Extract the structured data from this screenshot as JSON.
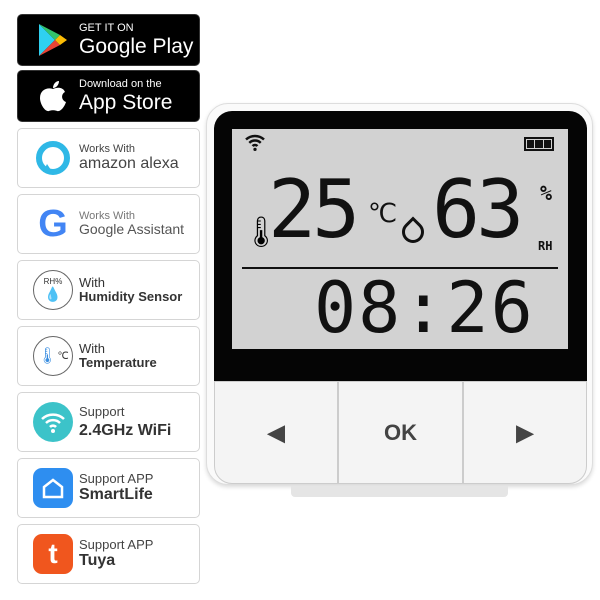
{
  "badges": [
    {
      "line1": "GET IT ON",
      "line2": "Google Play",
      "icon": "google-play-icon"
    },
    {
      "line1": "Download on the",
      "line2": "App Store",
      "icon": "apple-icon"
    },
    {
      "line1": "Works With",
      "line2": "amazon alexa",
      "icon": "alexa-icon"
    },
    {
      "line1": "Works With",
      "line2": "Google Assistant",
      "icon": "google-icon"
    },
    {
      "line1": "With",
      "line2": "Humidity Sensor",
      "icon": "humidity-icon",
      "icon_text": "RH%"
    },
    {
      "line1": "With",
      "line2": "Temperature",
      "icon": "thermometer-icon",
      "icon_text": "℃"
    },
    {
      "line1": "Support",
      "line2": "2.4GHz WiFi",
      "icon": "wifi-icon"
    },
    {
      "line1": "Support APP",
      "line2": "SmartLife",
      "icon": "smartlife-icon"
    },
    {
      "line1": "Support APP",
      "line2": "Tuya",
      "icon": "tuya-icon"
    }
  ],
  "display": {
    "temperature": "25",
    "temp_unit": "℃",
    "humidity": "63",
    "hum_unit": "%",
    "rh": "RH",
    "time": "08:26"
  },
  "buttons": {
    "left": "◀",
    "ok": "OK",
    "right": "▶"
  },
  "colors": {
    "alexa": "#2fb8e6",
    "wifi": "#3cc3c9",
    "smartlife": "#2e8ef0",
    "tuya": "#f0561e"
  }
}
